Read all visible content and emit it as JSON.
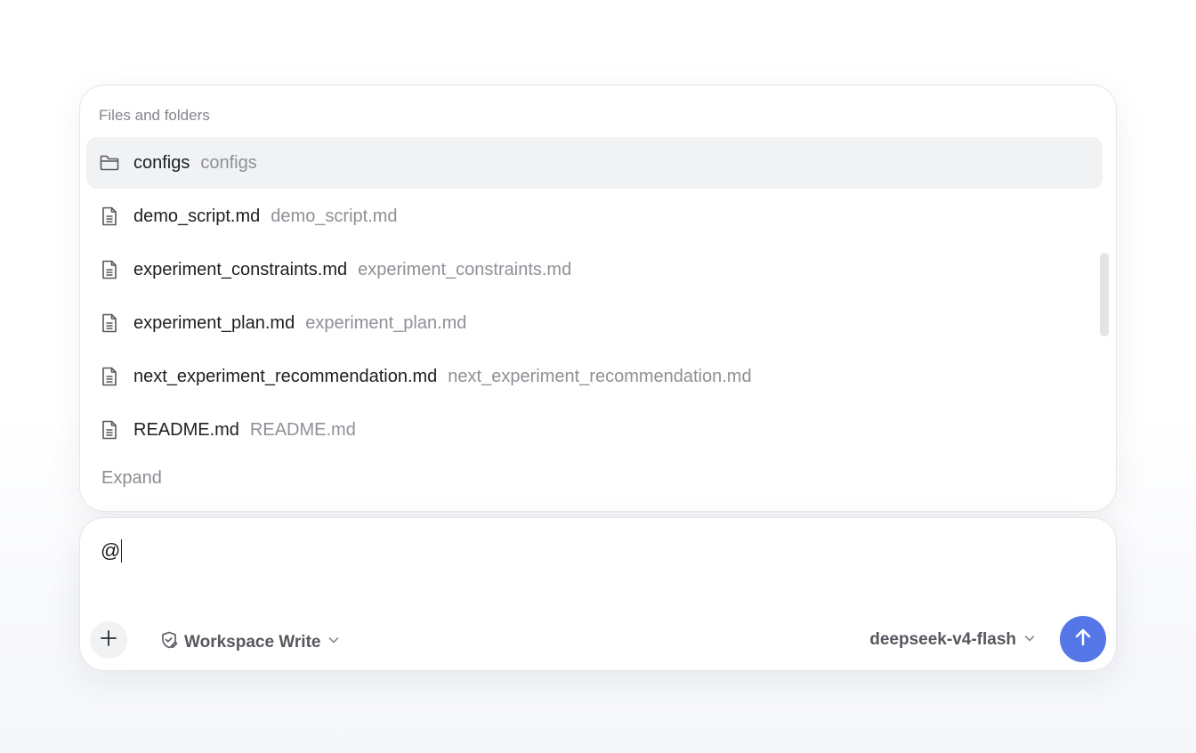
{
  "mention_popover": {
    "header": "Files and folders",
    "items": [
      {
        "icon": "folder-icon",
        "name": "configs",
        "path": "configs",
        "selected": true
      },
      {
        "icon": "file-icon",
        "name": "demo_script.md",
        "path": "demo_script.md",
        "selected": false
      },
      {
        "icon": "file-icon",
        "name": "experiment_constraints.md",
        "path": "experiment_constraints.md",
        "selected": false
      },
      {
        "icon": "file-icon",
        "name": "experiment_plan.md",
        "path": "experiment_plan.md",
        "selected": false
      },
      {
        "icon": "file-icon",
        "name": "next_experiment_recommendation.md",
        "path": "next_experiment_recommendation.md",
        "selected": false
      },
      {
        "icon": "file-icon",
        "name": "README.md",
        "path": "README.md",
        "selected": false
      }
    ],
    "expand_label": "Expand"
  },
  "composer": {
    "input_value": "@",
    "add_icon": "plus-icon",
    "mode": {
      "icon": "shield-edit-icon",
      "label": "Workspace Write"
    },
    "model": {
      "label": "deepseek-v4-flash"
    },
    "send_icon": "arrow-up-icon",
    "accent_color": "#5576e6"
  }
}
